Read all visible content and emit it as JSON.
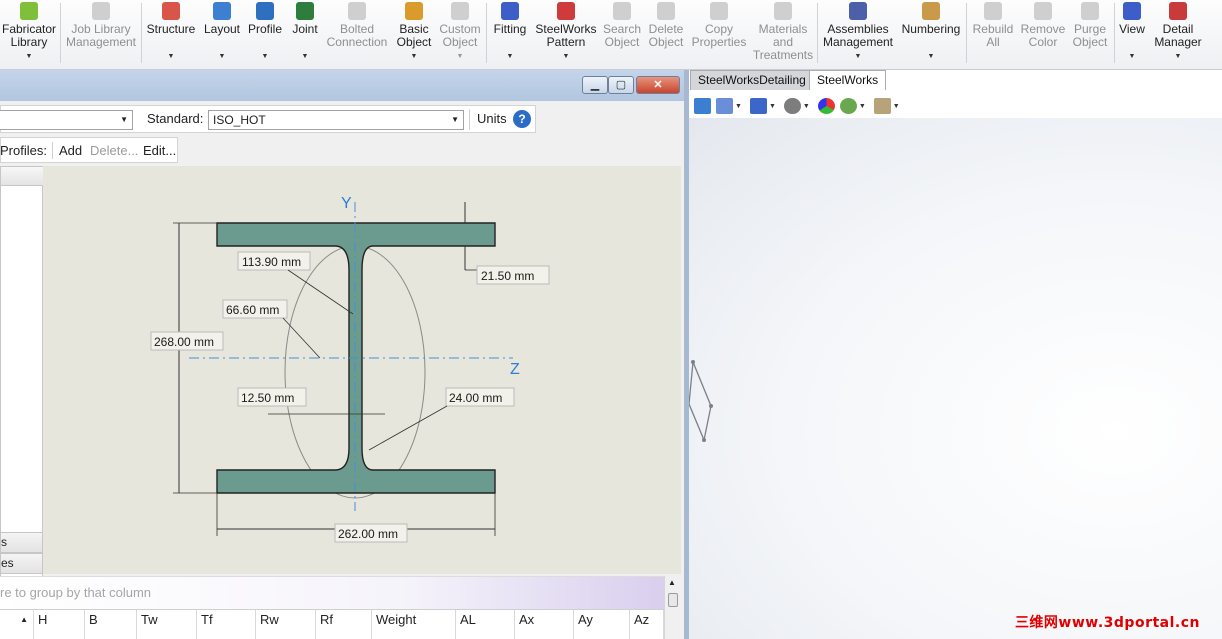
{
  "ribbon": {
    "buttons": [
      {
        "key": "fabricator",
        "label": "Fabricator Library",
        "icon": "fabricator-library-icon",
        "disabled": false
      },
      {
        "key": "joblib",
        "label": "Job Library Management",
        "icon": "job-library-icon",
        "disabled": true
      },
      {
        "key": "structure",
        "label": "Structure",
        "icon": "structure-icon",
        "disabled": false
      },
      {
        "key": "layout",
        "label": "Layout",
        "icon": "layout-icon",
        "disabled": false
      },
      {
        "key": "profile",
        "label": "Profile",
        "icon": "profile-icon",
        "disabled": false
      },
      {
        "key": "joint",
        "label": "Joint",
        "icon": "joint-icon",
        "disabled": false
      },
      {
        "key": "bolted",
        "label": "Bolted Connection",
        "icon": "bolted-connection-icon",
        "disabled": true
      },
      {
        "key": "basic",
        "label": "Basic Object",
        "icon": "basic-object-icon",
        "disabled": false
      },
      {
        "key": "custom",
        "label": "Custom Object",
        "icon": "custom-object-icon",
        "disabled": true
      },
      {
        "key": "fitting",
        "label": "Fitting",
        "icon": "fitting-icon",
        "disabled": false
      },
      {
        "key": "pattern",
        "label": "SteelWorks Pattern",
        "icon": "pattern-icon",
        "disabled": false
      },
      {
        "key": "search",
        "label": "Search Object",
        "icon": "search-object-icon",
        "disabled": true
      },
      {
        "key": "delete",
        "label": "Delete Object",
        "icon": "delete-object-icon",
        "disabled": true
      },
      {
        "key": "copy",
        "label": "Copy Properties",
        "icon": "copy-properties-icon",
        "disabled": true
      },
      {
        "key": "materials",
        "label": "Materials and Treatments",
        "icon": "materials-icon",
        "disabled": true
      },
      {
        "key": "assemblies",
        "label": "Assemblies Management",
        "icon": "assemblies-icon",
        "disabled": false
      },
      {
        "key": "numbering",
        "label": "Numbering",
        "icon": "numbering-icon",
        "disabled": false
      },
      {
        "key": "rebuild",
        "label": "Rebuild All",
        "icon": "rebuild-icon",
        "disabled": true
      },
      {
        "key": "removecolor",
        "label": "Remove Color",
        "icon": "remove-color-icon",
        "disabled": true
      },
      {
        "key": "purge",
        "label": "Purge Object",
        "icon": "purge-object-icon",
        "disabled": true
      },
      {
        "key": "view",
        "label": "View",
        "icon": "view-icon",
        "disabled": false
      },
      {
        "key": "detail",
        "label": "Detail Manager",
        "icon": "detail-manager-icon",
        "disabled": false
      }
    ]
  },
  "tabs": {
    "detailing": "SteelWorksDetailing",
    "steelworks": "SteelWorks"
  },
  "dialog": {
    "standard_label": "Standard:",
    "standard_value": "ISO_HOT",
    "units_label": "Units",
    "help_glyph": "?",
    "profiles_label": "Profiles:",
    "add_label": "Add",
    "delete_label": "Delete...",
    "edit_label": "Edit...",
    "list_rows": [
      "s",
      "es"
    ],
    "group_hint": "re to group by that column",
    "columns": [
      "H",
      "B",
      "Tw",
      "Tf",
      "Rw",
      "Rf",
      "Weight",
      "AL",
      "Ax",
      "Ay",
      "Az"
    ]
  },
  "drawing": {
    "axis_y": "Y",
    "axis_z": "Z",
    "dims": {
      "height": "268.00 mm",
      "width": "262.00 mm",
      "flange_thickness": "21.50 mm",
      "web_thickness": "12.50 mm",
      "radius": "24.00 mm",
      "dim_113": "113.90 mm",
      "dim_66": "66.60 mm"
    }
  },
  "colors": {
    "section_fill": "#6b9a8f",
    "axis": "#2a7fd6",
    "watermark": "#e00000"
  },
  "watermark": "三维网www.3dportal.cn"
}
